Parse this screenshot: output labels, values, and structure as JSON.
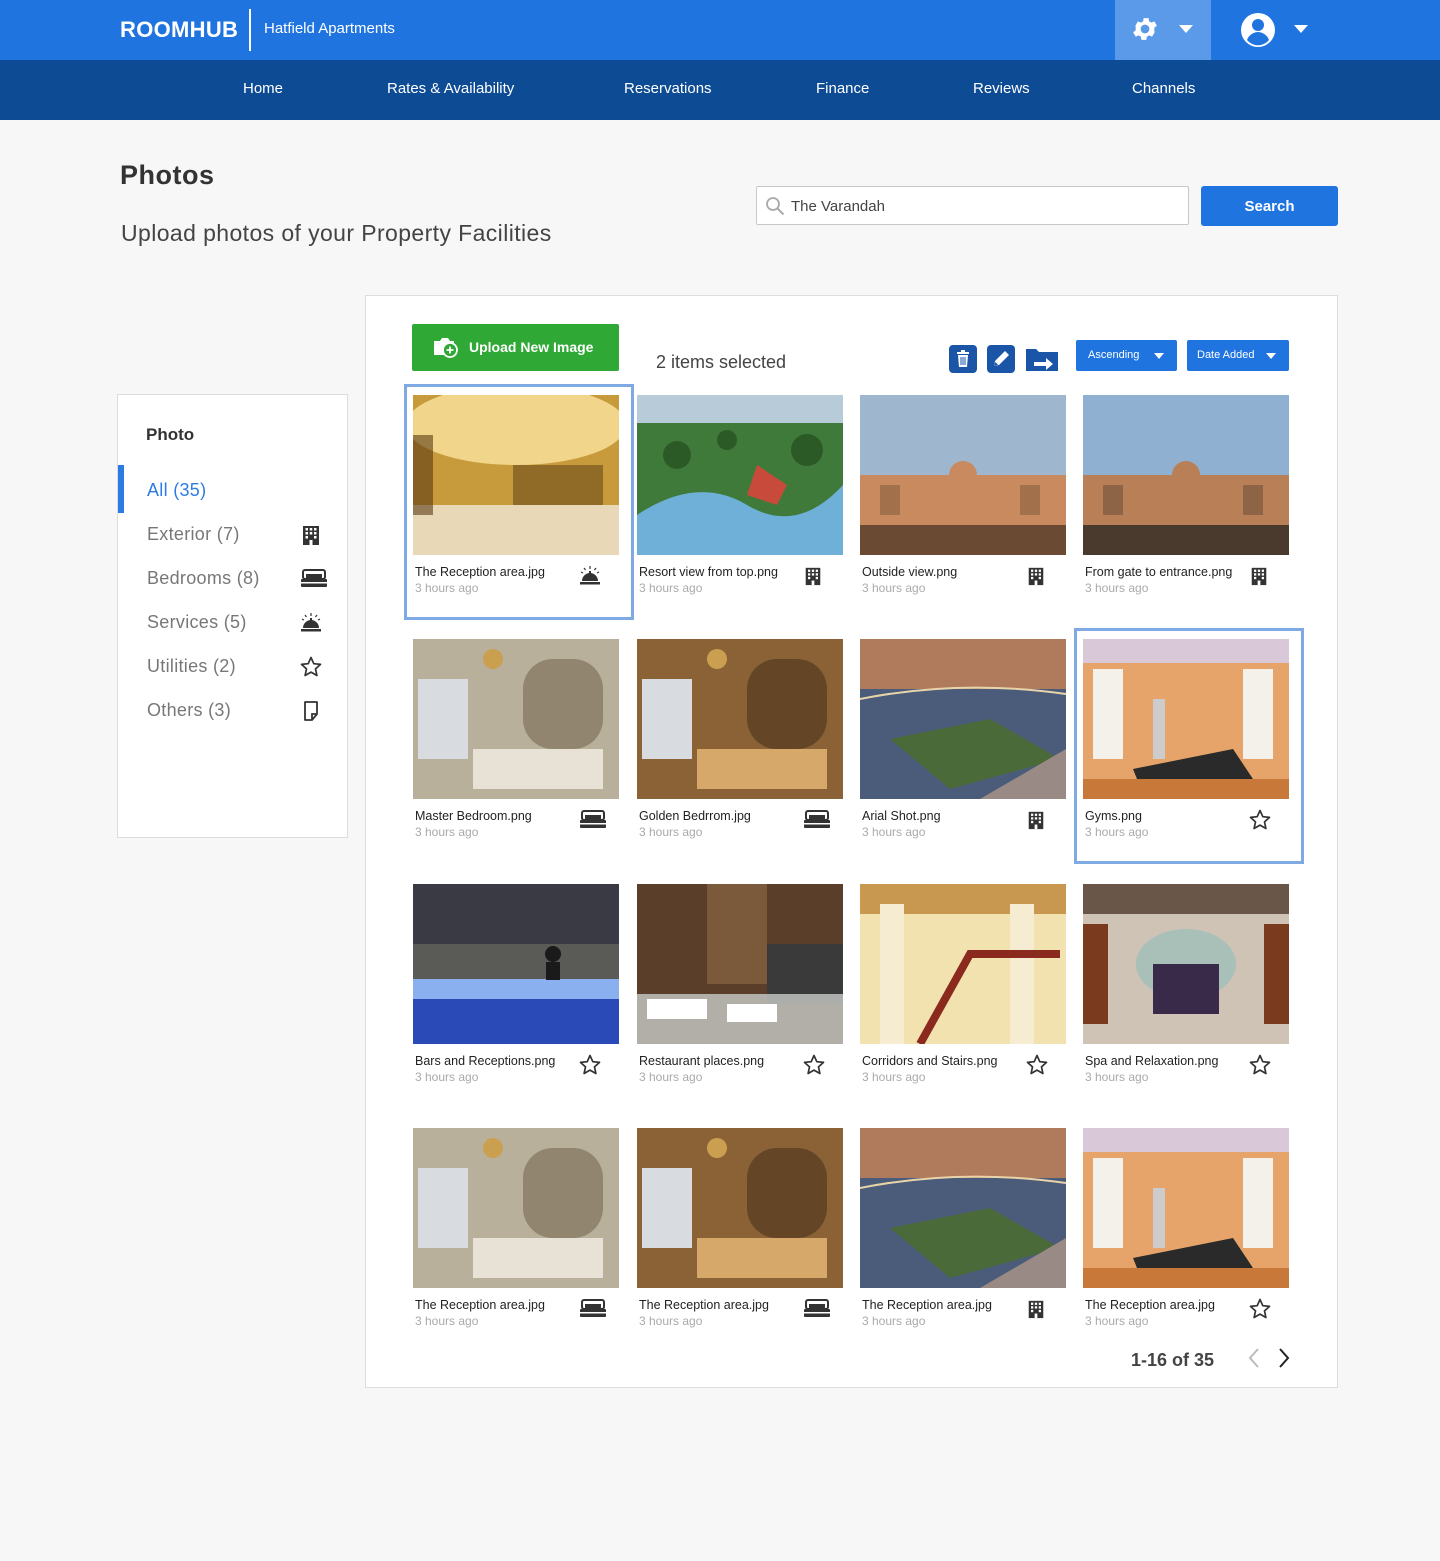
{
  "header": {
    "brand": "ROOMHUB",
    "property": "Hatfield Apartments",
    "settings_icon": "gear-icon",
    "user_icon": "account-circle-icon",
    "accent": "#1f74e0",
    "nav_bg": "#0d4b94"
  },
  "nav": [
    "Home",
    "Rates & Availability",
    "Reservations",
    "Finance",
    "Reviews",
    "Channels"
  ],
  "page": {
    "title": "Photos",
    "subtitle": "Upload photos of your Property Facilities"
  },
  "search": {
    "value": "The Varandah",
    "button": "Search"
  },
  "sidebar": {
    "title": "Photo",
    "categories": [
      {
        "label": "All (35)",
        "icon": "",
        "active": true
      },
      {
        "label": "Exterior (7)",
        "icon": "building-icon"
      },
      {
        "label": "Bedrooms (8)",
        "icon": "bed-icon"
      },
      {
        "label": "Services (5)",
        "icon": "service-bell-icon"
      },
      {
        "label": "Utilities (2)",
        "icon": "star-icon"
      },
      {
        "label": "Others (3)",
        "icon": "note-icon"
      }
    ]
  },
  "toolbar": {
    "upload_label": "Upload New Image",
    "selected_text": "2 items selected",
    "order_label": "Ascending",
    "sort_label": "Date Added",
    "upload_color": "#2fa836"
  },
  "photos": [
    {
      "name": "The Reception area.jpg",
      "time": "3 hours ago",
      "icon": "service-bell-icon",
      "selected": true
    },
    {
      "name": "Resort view from top.png",
      "time": "3 hours ago",
      "icon": "building-icon"
    },
    {
      "name": "Outside  view.png",
      "time": "3 hours ago",
      "icon": "building-icon"
    },
    {
      "name": "From gate to entrance.png",
      "time": "3 hours ago",
      "icon": "building-icon"
    },
    {
      "name": "Master Bedroom.png",
      "time": "3 hours ago",
      "icon": "bed-icon"
    },
    {
      "name": "Golden Bedrrom.jpg",
      "time": "3 hours ago",
      "icon": "bed-icon"
    },
    {
      "name": "Arial Shot.png",
      "time": "3 hours ago",
      "icon": "building-icon"
    },
    {
      "name": "Gyms.png",
      "time": "3 hours ago",
      "icon": "star-icon",
      "selected": true
    },
    {
      "name": "Bars and Receptions.png",
      "time": "3 hours ago",
      "icon": "star-icon"
    },
    {
      "name": "Restaurant places.png",
      "time": "3 hours ago",
      "icon": "star-icon"
    },
    {
      "name": "Corridors and Stairs.png",
      "time": "3 hours ago",
      "icon": "star-icon"
    },
    {
      "name": "Spa and Relaxation.png",
      "time": "3 hours ago",
      "icon": "star-icon"
    },
    {
      "name": "The Reception area.jpg",
      "time": "3 hours ago",
      "icon": "bed-icon"
    },
    {
      "name": "The Reception area.jpg",
      "time": "3 hours ago",
      "icon": "bed-icon"
    },
    {
      "name": "The Reception area.jpg",
      "time": "3 hours ago",
      "icon": "building-icon"
    },
    {
      "name": "The Reception area.jpg",
      "time": "3 hours ago",
      "icon": "star-icon"
    }
  ],
  "pagination": {
    "text": "1-16 of 35"
  }
}
